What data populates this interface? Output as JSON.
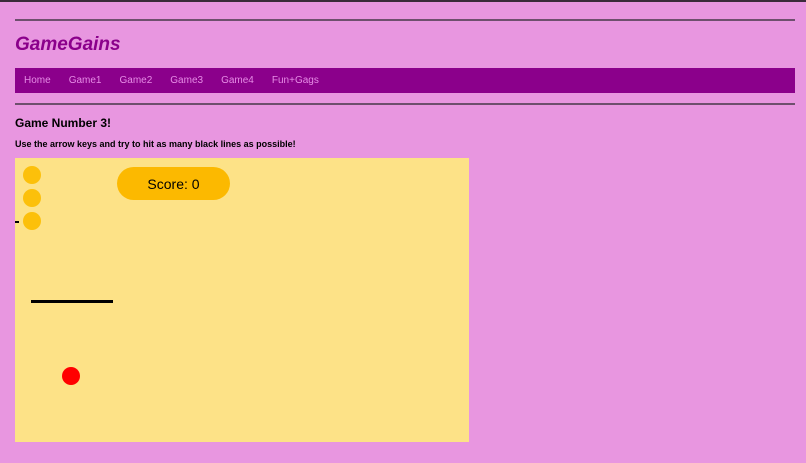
{
  "site": {
    "brand": "GameGains"
  },
  "nav": [
    {
      "label": "Home"
    },
    {
      "label": "Game1"
    },
    {
      "label": "Game2"
    },
    {
      "label": "Game3"
    },
    {
      "label": "Game4"
    },
    {
      "label": "Fun+Gags"
    }
  ],
  "page": {
    "heading": "Game Number 3!",
    "instructions": "Use the arrow keys and try to hit as many black lines as possible!"
  },
  "game": {
    "score_text": "Score: 0",
    "lives_remaining": 3,
    "colors": {
      "canvas": "#fde287",
      "life": "#fcc00a",
      "score_pill": "#fcb900",
      "ball": "#ff0000",
      "line": "#000000"
    }
  },
  "theme": {
    "background": "#e896e0",
    "nav_bg": "#8b008b",
    "brand_color": "#8b008b",
    "nav_link_color": "#e68ce6"
  }
}
